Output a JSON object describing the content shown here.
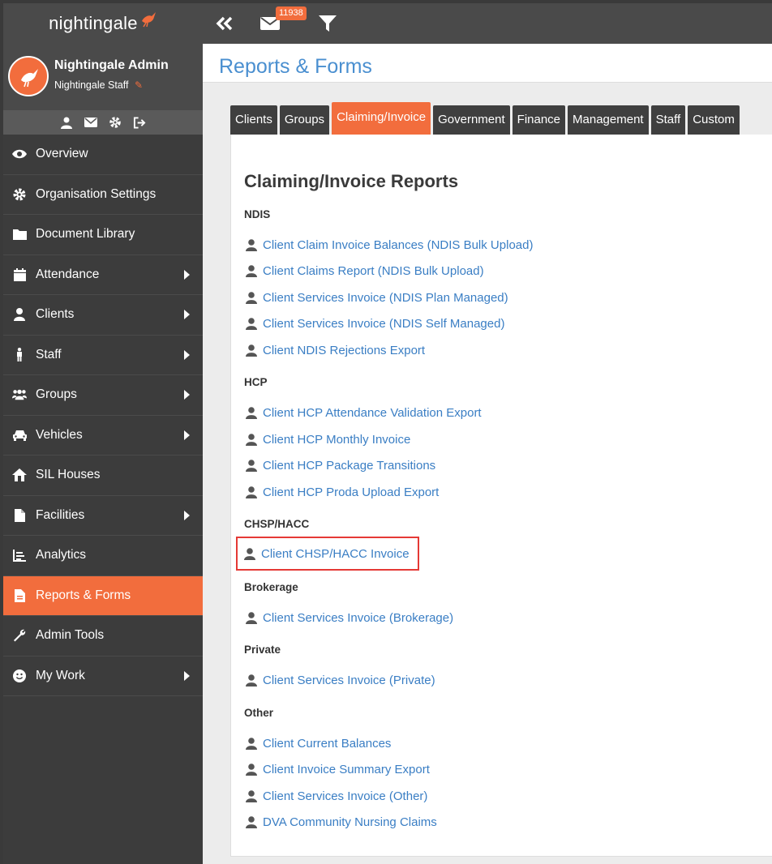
{
  "app": {
    "logo_text": "nightingale",
    "notifications_count": "11938"
  },
  "profile": {
    "name": "Nightingale Admin",
    "role": "Nightingale Staff"
  },
  "sidebar": {
    "items": [
      {
        "label": "Overview",
        "icon": "eye-icon",
        "has_arrow": false
      },
      {
        "label": "Organisation Settings",
        "icon": "gear-icon",
        "has_arrow": false
      },
      {
        "label": "Document Library",
        "icon": "folder-icon",
        "has_arrow": false
      },
      {
        "label": "Attendance",
        "icon": "calendar-icon",
        "has_arrow": true
      },
      {
        "label": "Clients",
        "icon": "user-icon",
        "has_arrow": true
      },
      {
        "label": "Staff",
        "icon": "person-standing-icon",
        "has_arrow": true
      },
      {
        "label": "Groups",
        "icon": "users-icon",
        "has_arrow": true
      },
      {
        "label": "Vehicles",
        "icon": "car-icon",
        "has_arrow": true
      },
      {
        "label": "SIL Houses",
        "icon": "house-icon",
        "has_arrow": false
      },
      {
        "label": "Facilities",
        "icon": "document-icon",
        "has_arrow": true
      },
      {
        "label": "Analytics",
        "icon": "chart-icon",
        "has_arrow": false
      },
      {
        "label": "Reports & Forms",
        "icon": "report-icon",
        "has_arrow": false,
        "active": true
      },
      {
        "label": "Admin Tools",
        "icon": "wrench-icon",
        "has_arrow": false
      },
      {
        "label": "My Work",
        "icon": "smile-icon",
        "has_arrow": true
      }
    ]
  },
  "main": {
    "title": "Reports & Forms",
    "tabs": [
      "Clients",
      "Groups",
      "Claiming/Invoice",
      "Government",
      "Finance",
      "Management",
      "Staff",
      "Custom"
    ],
    "active_tab": "Claiming/Invoice",
    "heading": "Claiming/Invoice Reports",
    "sections": [
      {
        "name": "NDIS",
        "links": [
          "Client Claim Invoice Balances (NDIS Bulk Upload)",
          "Client Claims Report (NDIS Bulk Upload)",
          "Client Services Invoice (NDIS Plan Managed)",
          "Client Services Invoice (NDIS Self Managed)",
          "Client NDIS Rejections Export"
        ]
      },
      {
        "name": "HCP",
        "links": [
          "Client HCP Attendance Validation Export",
          "Client HCP Monthly Invoice",
          "Client HCP Package Transitions",
          "Client HCP Proda Upload Export"
        ]
      },
      {
        "name": "CHSP/HACC",
        "links": [
          "Client CHSP/HACC Invoice"
        ]
      },
      {
        "name": "Brokerage",
        "links": [
          "Client Services Invoice (Brokerage)"
        ]
      },
      {
        "name": "Private",
        "links": [
          "Client Services Invoice (Private)"
        ]
      },
      {
        "name": "Other",
        "links": [
          "Client Current Balances",
          "Client Invoice Summary Export",
          "Client Services Invoice (Other)",
          "DVA Community Nursing Claims"
        ]
      }
    ]
  },
  "colors": {
    "accent": "#f26d3d",
    "link": "#3a7ec4",
    "title": "#4a8fd0",
    "sidebar_bg": "#3c3c3c",
    "highlight_border": "#e53935"
  }
}
